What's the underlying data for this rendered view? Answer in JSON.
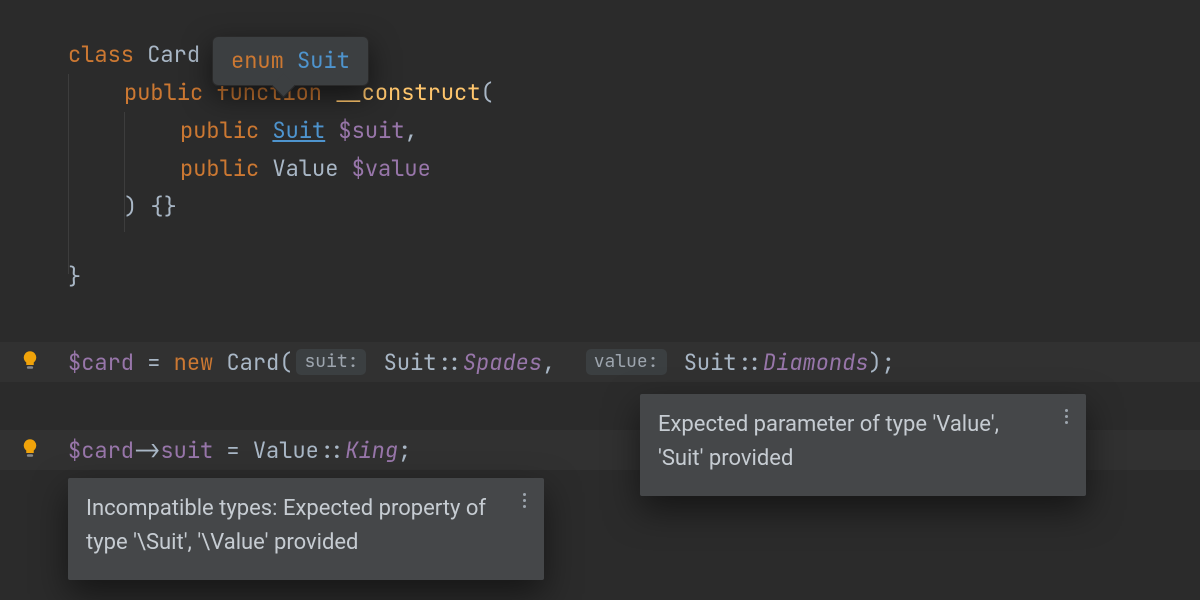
{
  "kw": {
    "class": "class",
    "public": "public",
    "function": "function",
    "new": "new",
    "enum": "enum"
  },
  "ident": {
    "Card": "Card",
    "construct": "__construct",
    "Suit": "Suit",
    "Value": "Value",
    "King": "King",
    "Spades": "Spades",
    "Diamonds": "Diamonds"
  },
  "vars": {
    "suit": "$suit",
    "value": "$value",
    "card": "$card"
  },
  "arrow_prop": "suit",
  "punct": {
    "obrace": " {",
    "oparen": "(",
    "comma": ",",
    "cparen": ")",
    "cempty": ") {}",
    "cbrace": "}",
    "scolon": ";",
    "dbl": "::",
    "arrow": "->",
    "eq": " = ",
    "cparen2": ");"
  },
  "hints": {
    "suit": "suit:",
    "value": "value:"
  },
  "tooltip": {
    "quickdoc_kw": "enum",
    "quickdoc_type": "Suit"
  },
  "inspections": {
    "paramType": "Expected parameter of type 'Value', 'Suit' provided",
    "incompat": "Incompatible types: Expected property of type '\\Suit', '\\Value' provided"
  }
}
